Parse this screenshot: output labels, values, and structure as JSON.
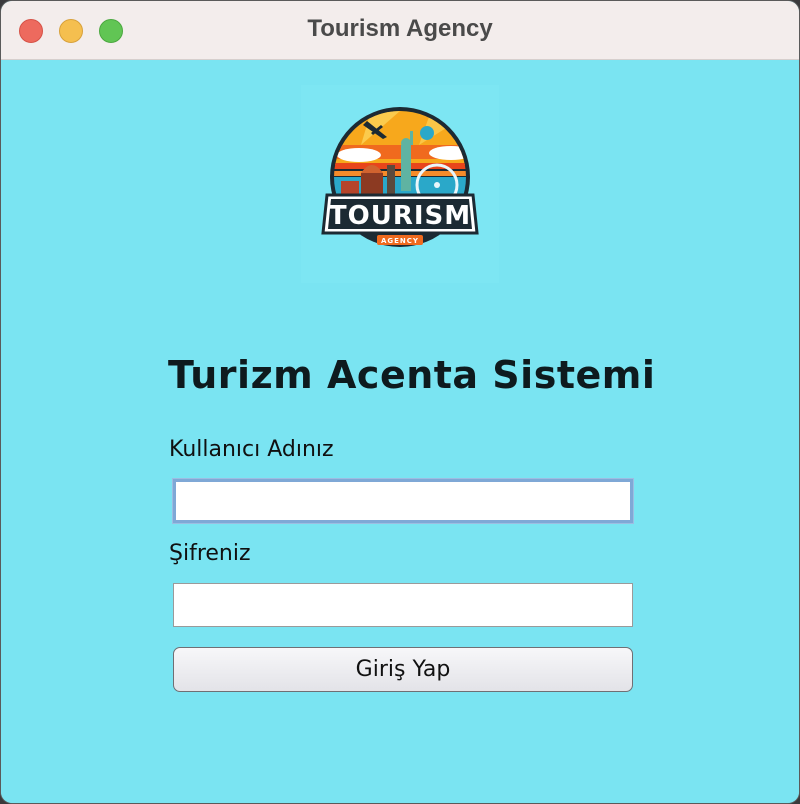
{
  "window": {
    "title": "Tourism Agency"
  },
  "logo": {
    "name": "TOURISM",
    "subname": "AGENCY"
  },
  "form": {
    "heading": "Turizm Acenta Sistemi",
    "username_label": "Kullanıcı Adınız",
    "username_value": "",
    "password_label": "Şifreniz",
    "password_value": "",
    "submit_label": "Giriş Yap"
  },
  "colors": {
    "background": "#7ae4f2",
    "titlebar": "#f3edec",
    "close": "#ed6a5e",
    "minimize": "#f5bf4f",
    "maximize": "#61c554",
    "focus_ring": "#7fa8d6"
  }
}
